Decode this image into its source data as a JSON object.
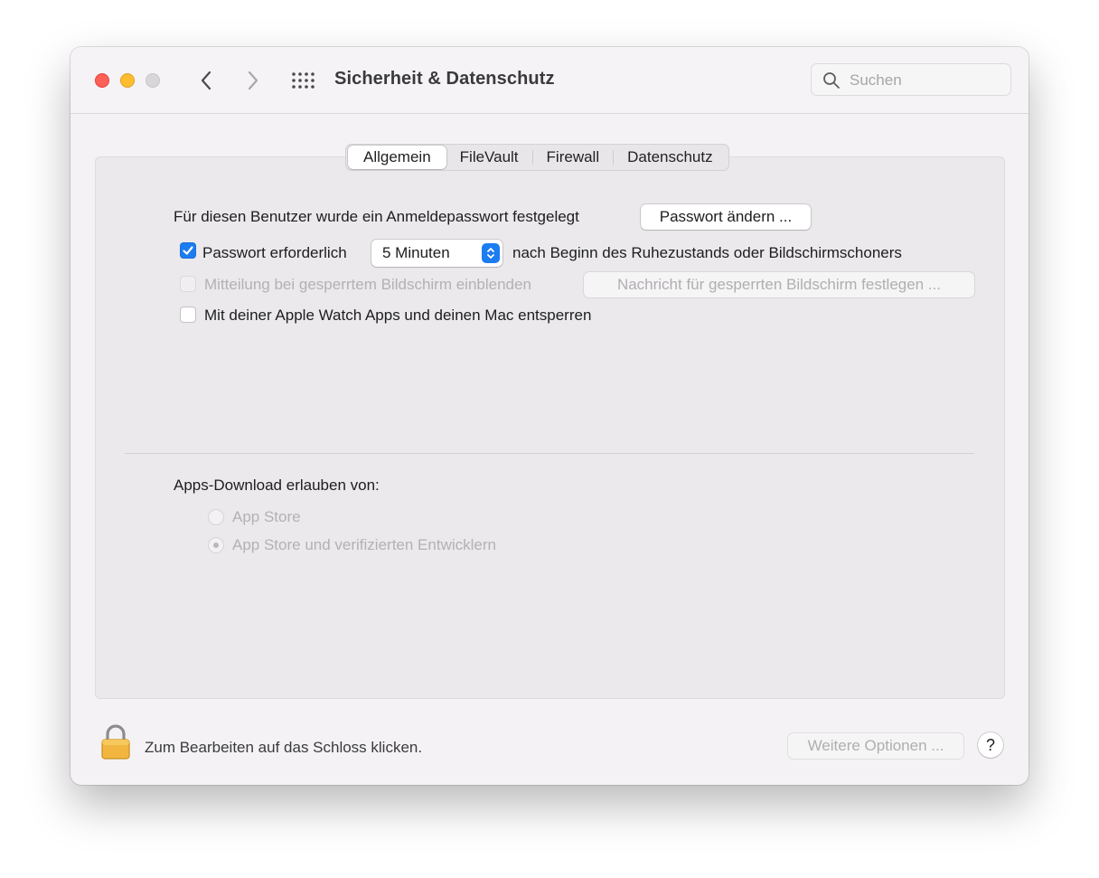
{
  "window": {
    "title": "Sicherheit & Datenschutz",
    "search": {
      "placeholder": "Suchen"
    }
  },
  "tabs": [
    {
      "label": "Allgemein",
      "active": true
    },
    {
      "label": "FileVault",
      "active": false
    },
    {
      "label": "Firewall",
      "active": false
    },
    {
      "label": "Datenschutz",
      "active": false
    }
  ],
  "general": {
    "password_label": "Für diesen Benutzer wurde ein Anmeldepasswort festgelegt",
    "change_password_button": "Passwort ändern ...",
    "require_password": {
      "label": "Passwort erforderlich",
      "checked": true,
      "delay_value": "5 Minuten",
      "suffix": "nach Beginn des Ruhezustands oder Bildschirmschoners"
    },
    "lock_message": {
      "label": "Mitteilung bei gesperrtem Bildschirm einblenden",
      "checked": false,
      "enabled": false,
      "button": "Nachricht für gesperrten Bildschirm festlegen ..."
    },
    "apple_watch": {
      "label": "Mit deiner Apple Watch Apps und deinen Mac entsperren",
      "checked": false
    }
  },
  "downloads": {
    "label": "Apps-Download erlauben von:",
    "options": [
      {
        "label": "App Store",
        "selected": false
      },
      {
        "label": "App Store und verifizierten Entwicklern",
        "selected": true
      }
    ]
  },
  "footer": {
    "lock_label": "Zum Bearbeiten auf das Schloss klicken.",
    "more_options_button": "Weitere Optionen ...",
    "help_button": "?"
  },
  "icons": {
    "close": "close-dot-icon",
    "minimize": "minimize-dot-icon",
    "zoom": "zoom-dot-icon",
    "back": "chevron-left-icon",
    "forward": "chevron-right-icon",
    "grid": "grid-icon",
    "search": "search-icon",
    "lock": "lock-icon",
    "checkmark": "checkmark-icon",
    "stepper": "chevron-up-down-icon"
  },
  "colors": {
    "accent": "#1c7cf2",
    "close": "#fe5f57",
    "minimize": "#febc2e",
    "lock_body": "#f2b640"
  }
}
